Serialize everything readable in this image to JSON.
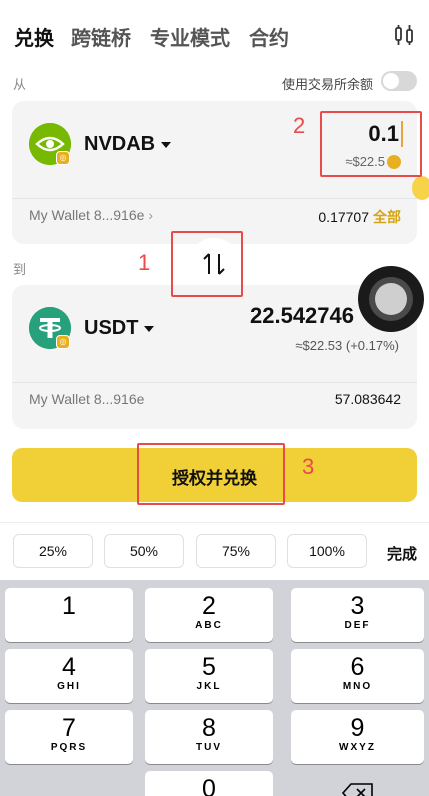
{
  "tabs": [
    "兑换",
    "跨链桥",
    "专业模式",
    "合约"
  ],
  "from_section": {
    "label": "从",
    "use_exchange_balance_label": "使用交易所余额",
    "token_symbol": "NVDAB",
    "amount": "0.1",
    "usd_value": "≈$22.5",
    "wallet": "My Wallet 8...916e",
    "balance": "0.17707",
    "max_label": "全部"
  },
  "to_section": {
    "label": "到",
    "token_symbol": "USDT",
    "amount": "22.542746",
    "usd_value": "≈$22.53 (+0.17%)",
    "wallet": "My Wallet 8...916e",
    "balance": "57.083642"
  },
  "annotations": [
    "1",
    "2",
    "3"
  ],
  "cta_label": "授权并兑换",
  "percent_options": [
    "25%",
    "50%",
    "75%",
    "100%"
  ],
  "done_label": "完成",
  "keypad": [
    {
      "n": "1",
      "s": ""
    },
    {
      "n": "2",
      "s": "ABC"
    },
    {
      "n": "3",
      "s": "DEF"
    },
    {
      "n": "4",
      "s": "GHI"
    },
    {
      "n": "5",
      "s": "JKL"
    },
    {
      "n": "6",
      "s": "MNO"
    },
    {
      "n": "7",
      "s": "PQRS"
    },
    {
      "n": "8",
      "s": "TUV"
    },
    {
      "n": "9",
      "s": "WXYZ"
    },
    {
      "n": "0",
      "s": ""
    }
  ],
  "colors": {
    "accent": "#f0cf37",
    "max_link": "#d4a514",
    "annotation": "#e94a4a"
  }
}
